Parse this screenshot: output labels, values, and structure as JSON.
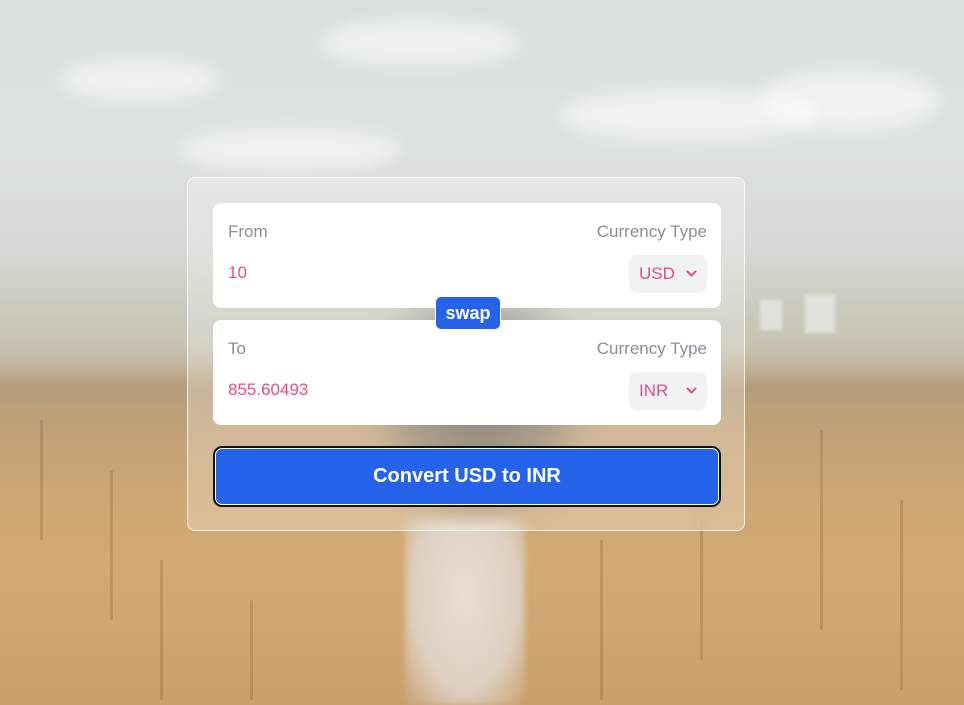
{
  "converter": {
    "from": {
      "label": "From",
      "currency_type_label": "Currency Type",
      "amount": "10",
      "currency": "USD"
    },
    "to": {
      "label": "To",
      "currency_type_label": "Currency Type",
      "amount": "855.60493",
      "currency": "INR"
    },
    "swap_label": "swap",
    "convert_label": "Convert USD to INR"
  },
  "colors": {
    "accent": "#2563eb",
    "amount_text": "#e04f8a",
    "label_text": "#8a8f96"
  },
  "icons": {
    "select_chevron": "chevron-down-icon"
  }
}
